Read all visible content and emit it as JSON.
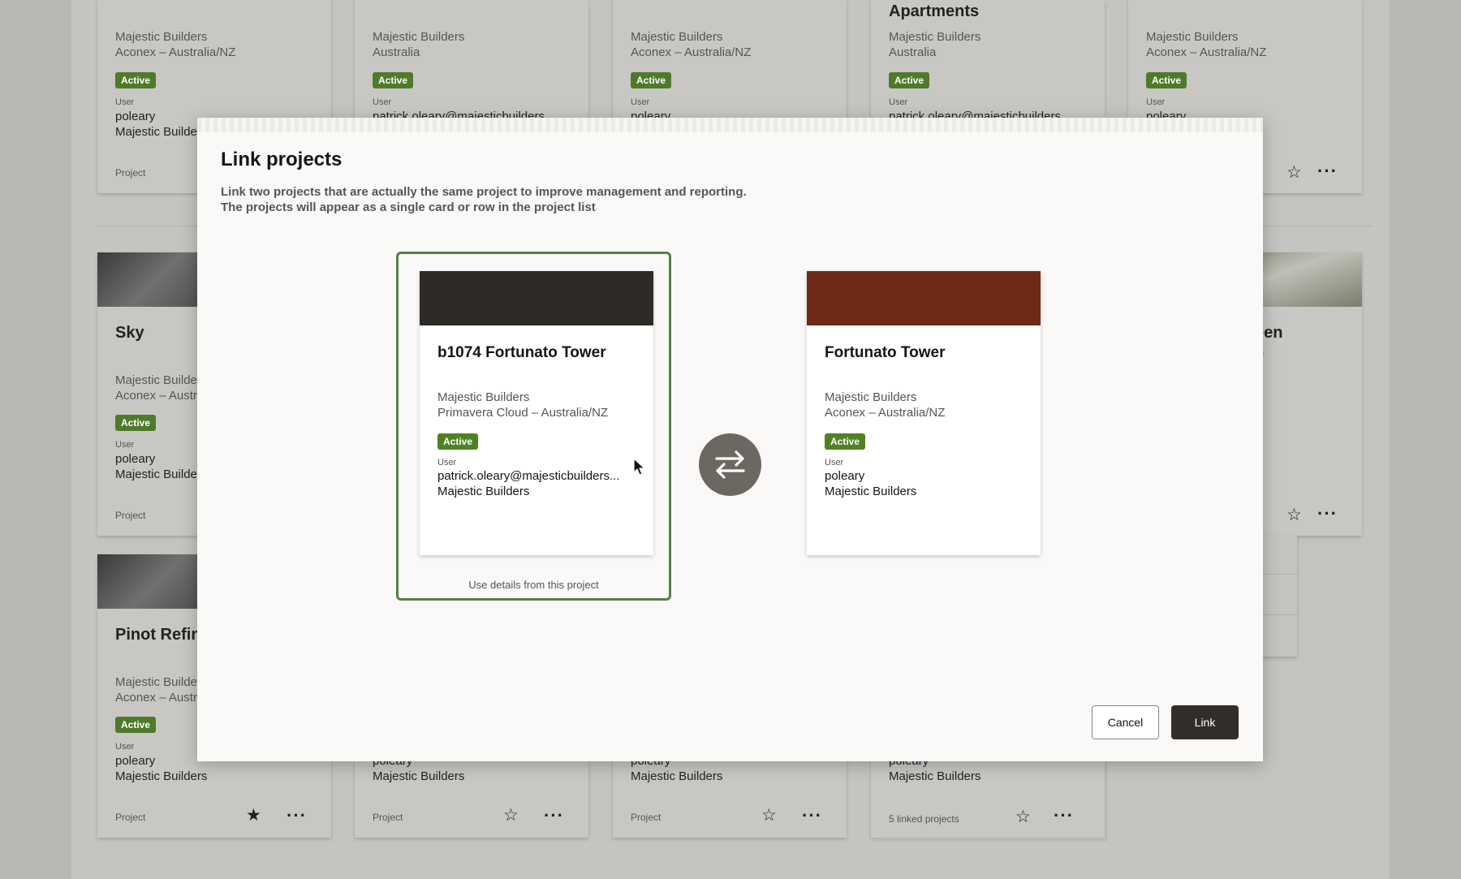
{
  "background": {
    "cards_row1": [
      {
        "title": "",
        "org": "Majestic Builders",
        "source": "Aconex – Australia/NZ",
        "status": "Active",
        "user_label": "User",
        "user": "poleary",
        "company": "Majestic Builde",
        "footer": "Project"
      },
      {
        "title": "",
        "org": "Majestic Builders",
        "source": "Australia",
        "status": "Active",
        "user_label": "User",
        "user": "patrick.oleary@majesticbuilders"
      },
      {
        "title": "",
        "org": "Majestic Builders",
        "source": "Aconex – Australia/NZ",
        "status": "Active",
        "user_label": "User",
        "user": "poleary"
      },
      {
        "title": "Apartments",
        "org": "Majestic Builders",
        "source": "Australia",
        "status": "Active",
        "user_label": "User",
        "user": "patrick.oleary@majesticbuilders"
      },
      {
        "title": "",
        "org": "Majestic Builders",
        "source": "Aconex – Australia/NZ",
        "status": "Active",
        "user_label": "User",
        "user": "poleary"
      }
    ],
    "cards_row2": [
      {
        "title": "Sky",
        "org": "Majestic Builde",
        "source": "Aconex – Austr",
        "status": "Active",
        "user_label": "User",
        "user": "poleary",
        "company": "Majestic Builde",
        "footer": "Project"
      },
      {
        "title_line1": "een",
        "title_line2": "e",
        "source": "Z"
      }
    ],
    "cards_row3": [
      {
        "title": "Pinot Refin",
        "org": "Majestic Builde",
        "source": "Aconex – Austr",
        "status": "Active",
        "user_label": "User",
        "user": "poleary",
        "company": "Majestic Builders",
        "footer": "Project"
      },
      {
        "user": "poleary",
        "company": "Majestic Builders",
        "footer": "Project"
      },
      {
        "user": "poleary",
        "company": "Majestic Builders",
        "footer": "Project"
      },
      {
        "user": "poleary",
        "company": "Majestic Builders",
        "footer": "5 linked projects"
      }
    ]
  },
  "modal": {
    "title": "Link projects",
    "description_line1": "Link two projects that are actually the same project to improve management and reporting.",
    "description_line2": "The projects will appear as a single card or row in the project list",
    "left_project": {
      "title": "b1074 Fortunato Tower",
      "org": "Majestic Builders",
      "source": "Primavera Cloud – Australia/NZ",
      "status": "Active",
      "user_label": "User",
      "user": "patrick.oleary@majesticbuilders...",
      "company": "Majestic Builders",
      "banner_color": "#2e2b27"
    },
    "right_project": {
      "title": "Fortunato Tower",
      "org": "Majestic Builders",
      "source": "Aconex – Australia/NZ",
      "status": "Active",
      "user_label": "User",
      "user": "poleary",
      "company": "Majestic Builders",
      "banner_color": "#6e2a17"
    },
    "use_details_label": "Use details from this project",
    "swap_icon": "swap-arrows-icon",
    "cancel_label": "Cancel",
    "link_label": "Link"
  },
  "colors": {
    "accent_green": "#558049",
    "badge_green": "#508223",
    "primary_button": "#312d2a"
  }
}
